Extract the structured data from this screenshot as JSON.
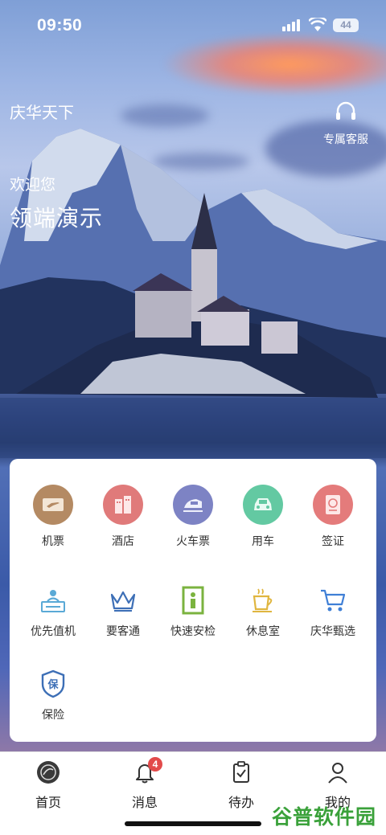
{
  "status_bar": {
    "time": "09:50",
    "battery": "44"
  },
  "header": {
    "brand": "庆华天下",
    "service_label": "专属客服",
    "welcome_small": "欢迎您",
    "welcome_big": "领端演示"
  },
  "services": [
    {
      "label": "机票",
      "icon": "flight-ticket-icon",
      "color": "#b48a63"
    },
    {
      "label": "酒店",
      "icon": "hotel-icon",
      "color": "#e07a7a"
    },
    {
      "label": "火车票",
      "icon": "train-icon",
      "color": "#7d83c4"
    },
    {
      "label": "用车",
      "icon": "car-icon",
      "color": "#63c9a2"
    },
    {
      "label": "签证",
      "icon": "visa-icon",
      "color": "#e47b7b"
    },
    {
      "label": "优先值机",
      "icon": "priority-checkin-icon",
      "color": "#5aa9d6"
    },
    {
      "label": "要客通",
      "icon": "crown-icon",
      "color": "#3d6fb6"
    },
    {
      "label": "快速安检",
      "icon": "security-gate-icon",
      "color": "#7bb33f"
    },
    {
      "label": "休息室",
      "icon": "coffee-cup-icon",
      "color": "#e0b640"
    },
    {
      "label": "庆华甄选",
      "icon": "shopping-cart-icon",
      "color": "#3f7fd6"
    },
    {
      "label": "保险",
      "icon": "insurance-shield-icon",
      "color": "#3d6fb6"
    }
  ],
  "tabbar": {
    "tabs": [
      {
        "label": "首页",
        "icon": "home-logo-icon"
      },
      {
        "label": "消息",
        "icon": "bell-icon",
        "badge": "4"
      },
      {
        "label": "待办",
        "icon": "clipboard-check-icon"
      },
      {
        "label": "我的",
        "icon": "user-icon"
      }
    ]
  },
  "watermark": "谷普软件园"
}
